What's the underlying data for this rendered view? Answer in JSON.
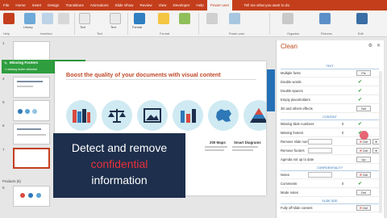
{
  "tabs": [
    "File",
    "Home",
    "Insert",
    "Design",
    "Transitions",
    "Animations",
    "Slide Show",
    "Review",
    "View",
    "Developer",
    "Help",
    "Power-user"
  ],
  "active_tab": "Power-user",
  "tellme": "Tell me what you want to do",
  "ribbon_groups": [
    "Help",
    "Insertion",
    "Text",
    "Format",
    "Power-user",
    "Organize",
    "Pictures",
    "Edit"
  ],
  "ribbon_buttons": [
    "Library",
    "Text",
    "Text",
    "Format"
  ],
  "notification": {
    "title": "Missing Footers",
    "subtitle": "1 missing footer detected",
    "ok": "✔"
  },
  "slide": {
    "title": "Boost the quality of your documents with visual content",
    "captions": [
      "200 Maps",
      "Smart Diagrams"
    ]
  },
  "callout": {
    "line1": "Detect and remove",
    "line2": "confidential",
    "line3": "information"
  },
  "section_label": "Products (6)",
  "clean": {
    "title": "Clean",
    "sections": [
      "TEXT",
      "CONTENT",
      "CONFIDENTIALITY",
      "SLIDE SIZE"
    ],
    "text_rows": [
      {
        "label": "Multiple fonts",
        "count": "",
        "btn": "Fix"
      },
      {
        "label": "Double words",
        "count": "",
        "btn": ""
      },
      {
        "label": "Double spaces",
        "count": "",
        "btn": ""
      },
      {
        "label": "Empty placeholders",
        "count": "",
        "btn": ""
      },
      {
        "label": "3D and others effects",
        "count": "",
        "btn": "Set"
      }
    ],
    "content_rows": [
      {
        "label": "Missing slide numbers",
        "count": "0",
        "btn": ""
      },
      {
        "label": "Missing footers",
        "count": "0",
        "btn": ""
      },
      {
        "label": "Remove slide numbers",
        "count": "",
        "btn": "Del"
      },
      {
        "label": "Remove footers",
        "count": "",
        "btn": "Del"
      },
      {
        "label": "Agenda not up to date",
        "count": "",
        "btn": "Up"
      }
    ],
    "conf_rows": [
      {
        "label": "Notes",
        "count": "",
        "btn": "Del"
      },
      {
        "label": "Comments",
        "count": "0",
        "btn": ""
      },
      {
        "label": "Mode notes",
        "count": "",
        "btn": "Del"
      }
    ],
    "size_rows": [
      {
        "label": "Fully off-slide content",
        "count": "",
        "btn": "Del"
      }
    ]
  }
}
